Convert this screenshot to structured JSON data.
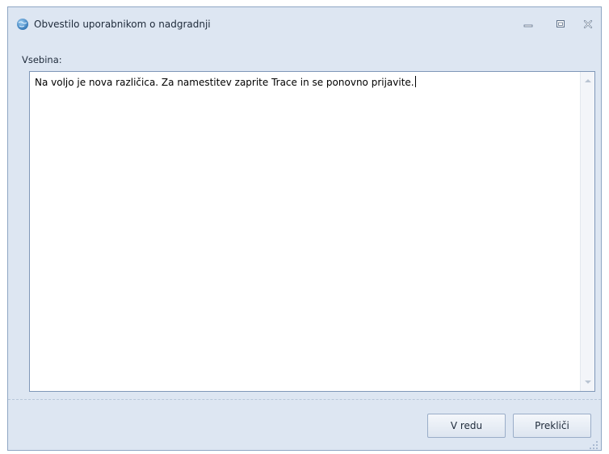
{
  "window": {
    "title": "Obvestilo uporabnikom o nadgradnji",
    "app_icon": "globe-app-icon",
    "controls": {
      "minimize_icon": "minimize-icon",
      "maximize_icon": "maximize-icon",
      "close_icon": "close-icon"
    }
  },
  "form": {
    "content_label": "Vsebina:",
    "content_value": "Na voljo je nova različica. Za namestitev zaprite Trace in se ponovno prijavite."
  },
  "buttons": {
    "ok_label": "V redu",
    "cancel_label": "Prekliči"
  },
  "colors": {
    "window_background": "#dde6f2",
    "window_border": "#8fa6c4",
    "text": "#1e2a3a"
  }
}
